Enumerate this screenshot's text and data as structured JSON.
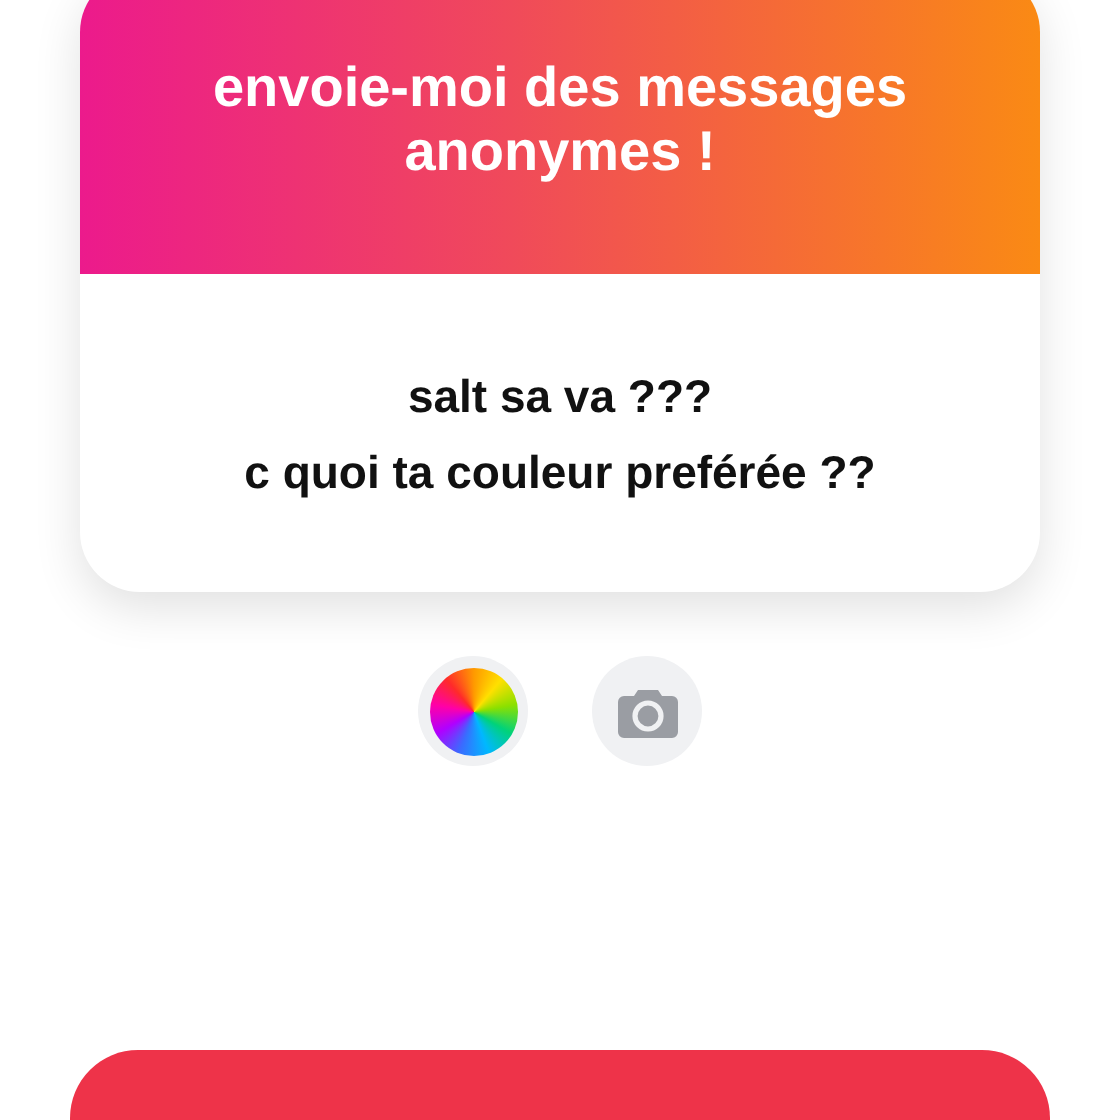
{
  "prompt_card": {
    "title": "envoie-moi des messages anonymes !",
    "message_lines": [
      "salt sa va ???",
      "c quoi ta couleur preférée ??"
    ]
  }
}
